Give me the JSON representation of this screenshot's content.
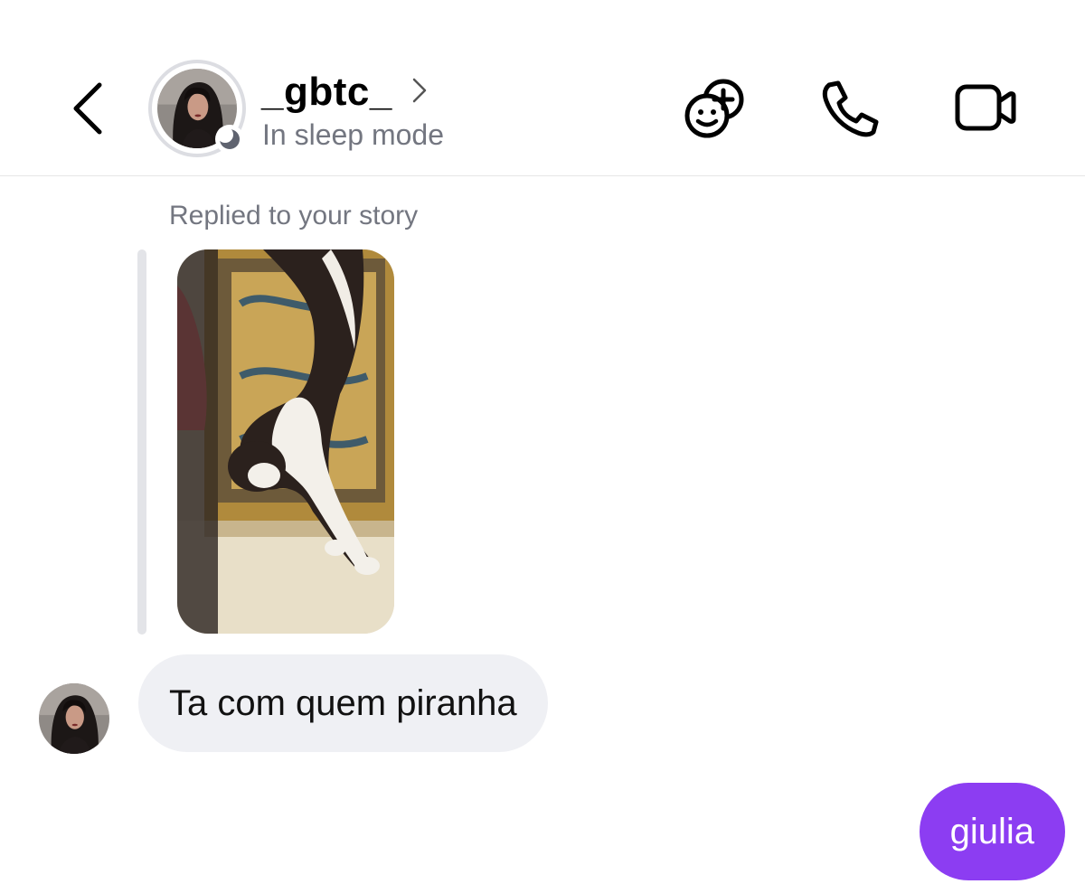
{
  "header": {
    "contact_name": "_gbtc_",
    "status": "In sleep mode",
    "icons": {
      "back": "chevron-left-icon",
      "name_chevron": "chevron-right-icon",
      "effects": "effects-add-icon",
      "call": "phone-icon",
      "video": "video-camera-icon"
    }
  },
  "thread": {
    "reply_label": "Replied to your story",
    "messages": [
      {
        "direction": "incoming",
        "text": "Ta com quem piranha"
      },
      {
        "direction": "outgoing",
        "text": "giulia"
      }
    ]
  },
  "colors": {
    "outgoing_bubble": "#8c3df2",
    "incoming_bubble": "#eff0f4",
    "secondary_text": "#737680",
    "avatar_ring": "#dcdde2"
  }
}
